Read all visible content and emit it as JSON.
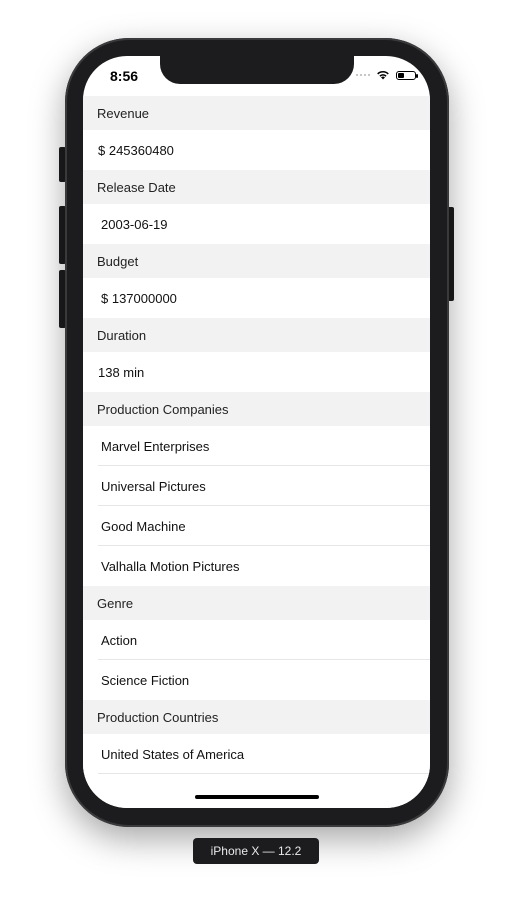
{
  "status_bar": {
    "time": "8:56"
  },
  "sections": [
    {
      "header": "Revenue",
      "rows": [
        "$ 245360480"
      ]
    },
    {
      "header": "Release Date",
      "rows": [
        "2003-06-19"
      ]
    },
    {
      "header": "Budget",
      "rows": [
        "$ 137000000"
      ]
    },
    {
      "header": "Duration",
      "rows": [
        "138 min"
      ]
    },
    {
      "header": "Production Companies",
      "rows": [
        "Marvel Enterprises",
        "Universal Pictures",
        "Good Machine",
        "Valhalla Motion Pictures"
      ]
    },
    {
      "header": "Genre",
      "rows": [
        "Action",
        "Science Fiction"
      ]
    },
    {
      "header": "Production Countries",
      "rows": [
        "United States of America"
      ]
    }
  ],
  "device_label": "iPhone X — 12.2"
}
